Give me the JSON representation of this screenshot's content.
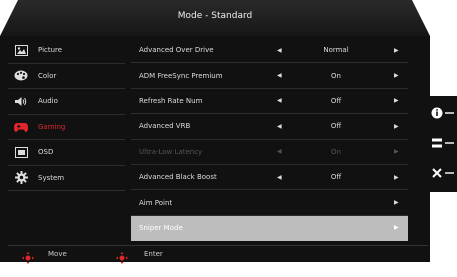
{
  "header": {
    "title": "Mode - Standard"
  },
  "sidebar": {
    "items": [
      {
        "label": "Picture",
        "icon": "picture-icon"
      },
      {
        "label": "Color",
        "icon": "color-palette-icon"
      },
      {
        "label": "Audio",
        "icon": "speaker-icon"
      },
      {
        "label": "Gaming",
        "icon": "gamepad-icon",
        "active": true
      },
      {
        "label": "OSD",
        "icon": "osd-icon"
      },
      {
        "label": "System",
        "icon": "gear-icon"
      }
    ]
  },
  "settings": {
    "rows": [
      {
        "label": "Advanced Over Drive",
        "value": "Normal"
      },
      {
        "label": "ADM FreeSync Premium",
        "value": "On"
      },
      {
        "label": "Refresh Rate Num",
        "value": "Off"
      },
      {
        "label": "Advanced VRB",
        "value": "Off"
      },
      {
        "label": "Ultra-Low Latency",
        "value": "On",
        "disabled": true
      },
      {
        "label": "Advanced Black Boost",
        "value": "Off"
      },
      {
        "label": "Aim Point",
        "value": ""
      },
      {
        "label": "Sniper Mode",
        "value": "",
        "selected": true
      }
    ]
  },
  "footer": {
    "move_label": "Move",
    "enter_label": "Enter"
  },
  "side_buttons": [
    "info-icon",
    "menu-icon",
    "close-icon"
  ],
  "colors": {
    "accent": "#e0262a",
    "selected_row": "#bdbdbd",
    "background": "#111111"
  }
}
